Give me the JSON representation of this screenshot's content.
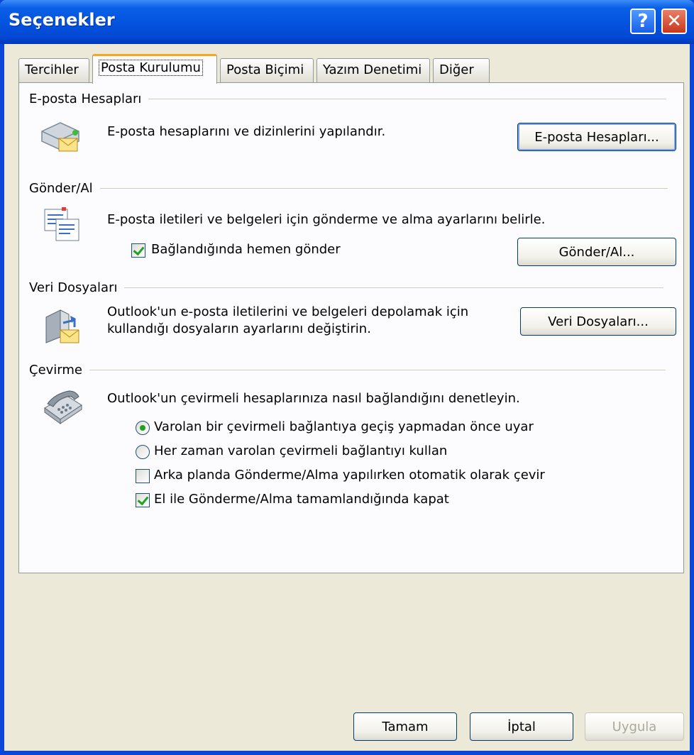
{
  "window": {
    "title": "Seçenekler",
    "help_glyph": "?",
    "close_glyph": "✕"
  },
  "tabs": [
    {
      "label": "Tercihler"
    },
    {
      "label": "Posta Kurulumu"
    },
    {
      "label": "Posta Biçimi"
    },
    {
      "label": "Yazım Denetimi"
    },
    {
      "label": "Diğer"
    }
  ],
  "sections": {
    "accounts": {
      "heading": "E-posta Hesapları",
      "description": "E-posta hesaplarını ve dizinlerini yapılandır.",
      "button": "E-posta Hesapları...",
      "icon": "mail-accounts-icon"
    },
    "send_receive": {
      "heading": "Gönder/Al",
      "description": "E-posta iletileri ve belgeleri için gönderme ve alma ayarlarını belirle.",
      "checkbox_label": "Bağlandığında hemen gönder",
      "checkbox_checked": true,
      "button": "Gönder/Al...",
      "icon": "send-receive-icon"
    },
    "data_files": {
      "heading": "Veri Dosyaları",
      "description_line1": "Outlook'un e-posta iletilerini ve belgeleri depolamak için",
      "description_line2": "kullandığı dosyaların ayarlarını değiştirin.",
      "button": "Veri Dosyaları...",
      "icon": "data-files-icon"
    },
    "dialup": {
      "heading": "Çevirme",
      "description": "Outlook'un çevirmeli hesaplarınıza nasıl bağlandığını denetleyin.",
      "icon": "telephone-icon",
      "options": [
        {
          "label": "Varolan bir çevirmeli bağlantıya geçiş yapmadan önce uyar",
          "type": "radio",
          "checked": true
        },
        {
          "label": "Her zaman varolan çevirmeli bağlantıyı kullan",
          "type": "radio",
          "checked": false
        },
        {
          "label": "Arka planda Gönderme/Alma yapılırken otomatik olarak çevir",
          "type": "checkbox",
          "checked": false
        },
        {
          "label": "El ile Gönderme/Alma tamamlandığında kapat",
          "type": "checkbox",
          "checked": true
        }
      ]
    }
  },
  "footer": {
    "ok": "Tamam",
    "cancel": "İptal",
    "apply": "Uygula"
  },
  "colors": {
    "titlebar": "#0354e0",
    "dialog_bg": "#ece9d8",
    "panel_bg": "#fcfcfe",
    "active_tab_accent": "#f5a623",
    "check_mark": "#21a121"
  }
}
